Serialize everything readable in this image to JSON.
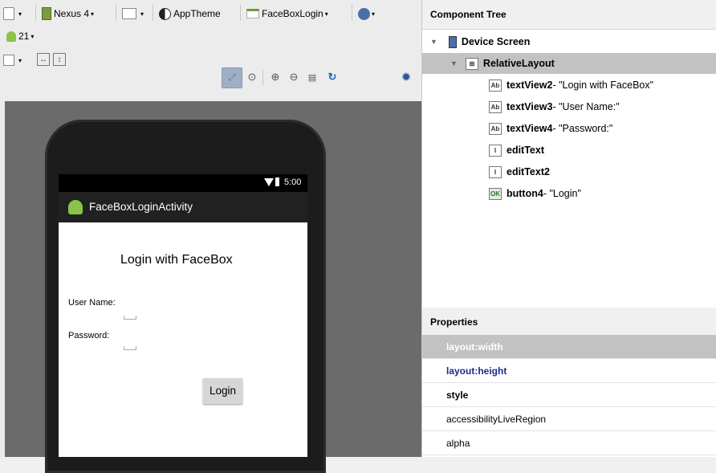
{
  "toolbar": {
    "device": "Nexus 4",
    "theme": "AppTheme",
    "activity": "FaceBoxLogin",
    "api_level": "21"
  },
  "preview": {
    "status_time": "5:00",
    "app_title": "FaceBoxLoginActivity",
    "heading": "Login with FaceBox",
    "user_label": "User Name:",
    "password_label": "Password:",
    "login_button": "Login"
  },
  "component_tree": {
    "title": "Component Tree",
    "device_screen": "Device Screen",
    "layout": "RelativeLayout",
    "items": [
      {
        "id": "textView2",
        "suffix": " - \"Login with FaceBox\"",
        "icon": "textview-icon"
      },
      {
        "id": "textView3",
        "suffix": " - \"User Name:\"",
        "icon": "textview-icon"
      },
      {
        "id": "textView4",
        "suffix": " - \"Password:\"",
        "icon": "textview-icon"
      },
      {
        "id": "editText",
        "suffix": "",
        "icon": "edittext-icon"
      },
      {
        "id": "editText2",
        "suffix": "",
        "icon": "edittext-icon"
      },
      {
        "id": "button4",
        "suffix": " - \"Login\"",
        "icon": "button-icon"
      }
    ]
  },
  "properties": {
    "title": "Properties",
    "rows": [
      "layout:width",
      "layout:height",
      "style",
      "accessibilityLiveRegion",
      "alpha"
    ]
  },
  "colors": {
    "selected_row": "#c2c2c2",
    "property_link": "#1a2a8a",
    "action_bar": "#212121",
    "canvas": "#6b6b6b"
  }
}
